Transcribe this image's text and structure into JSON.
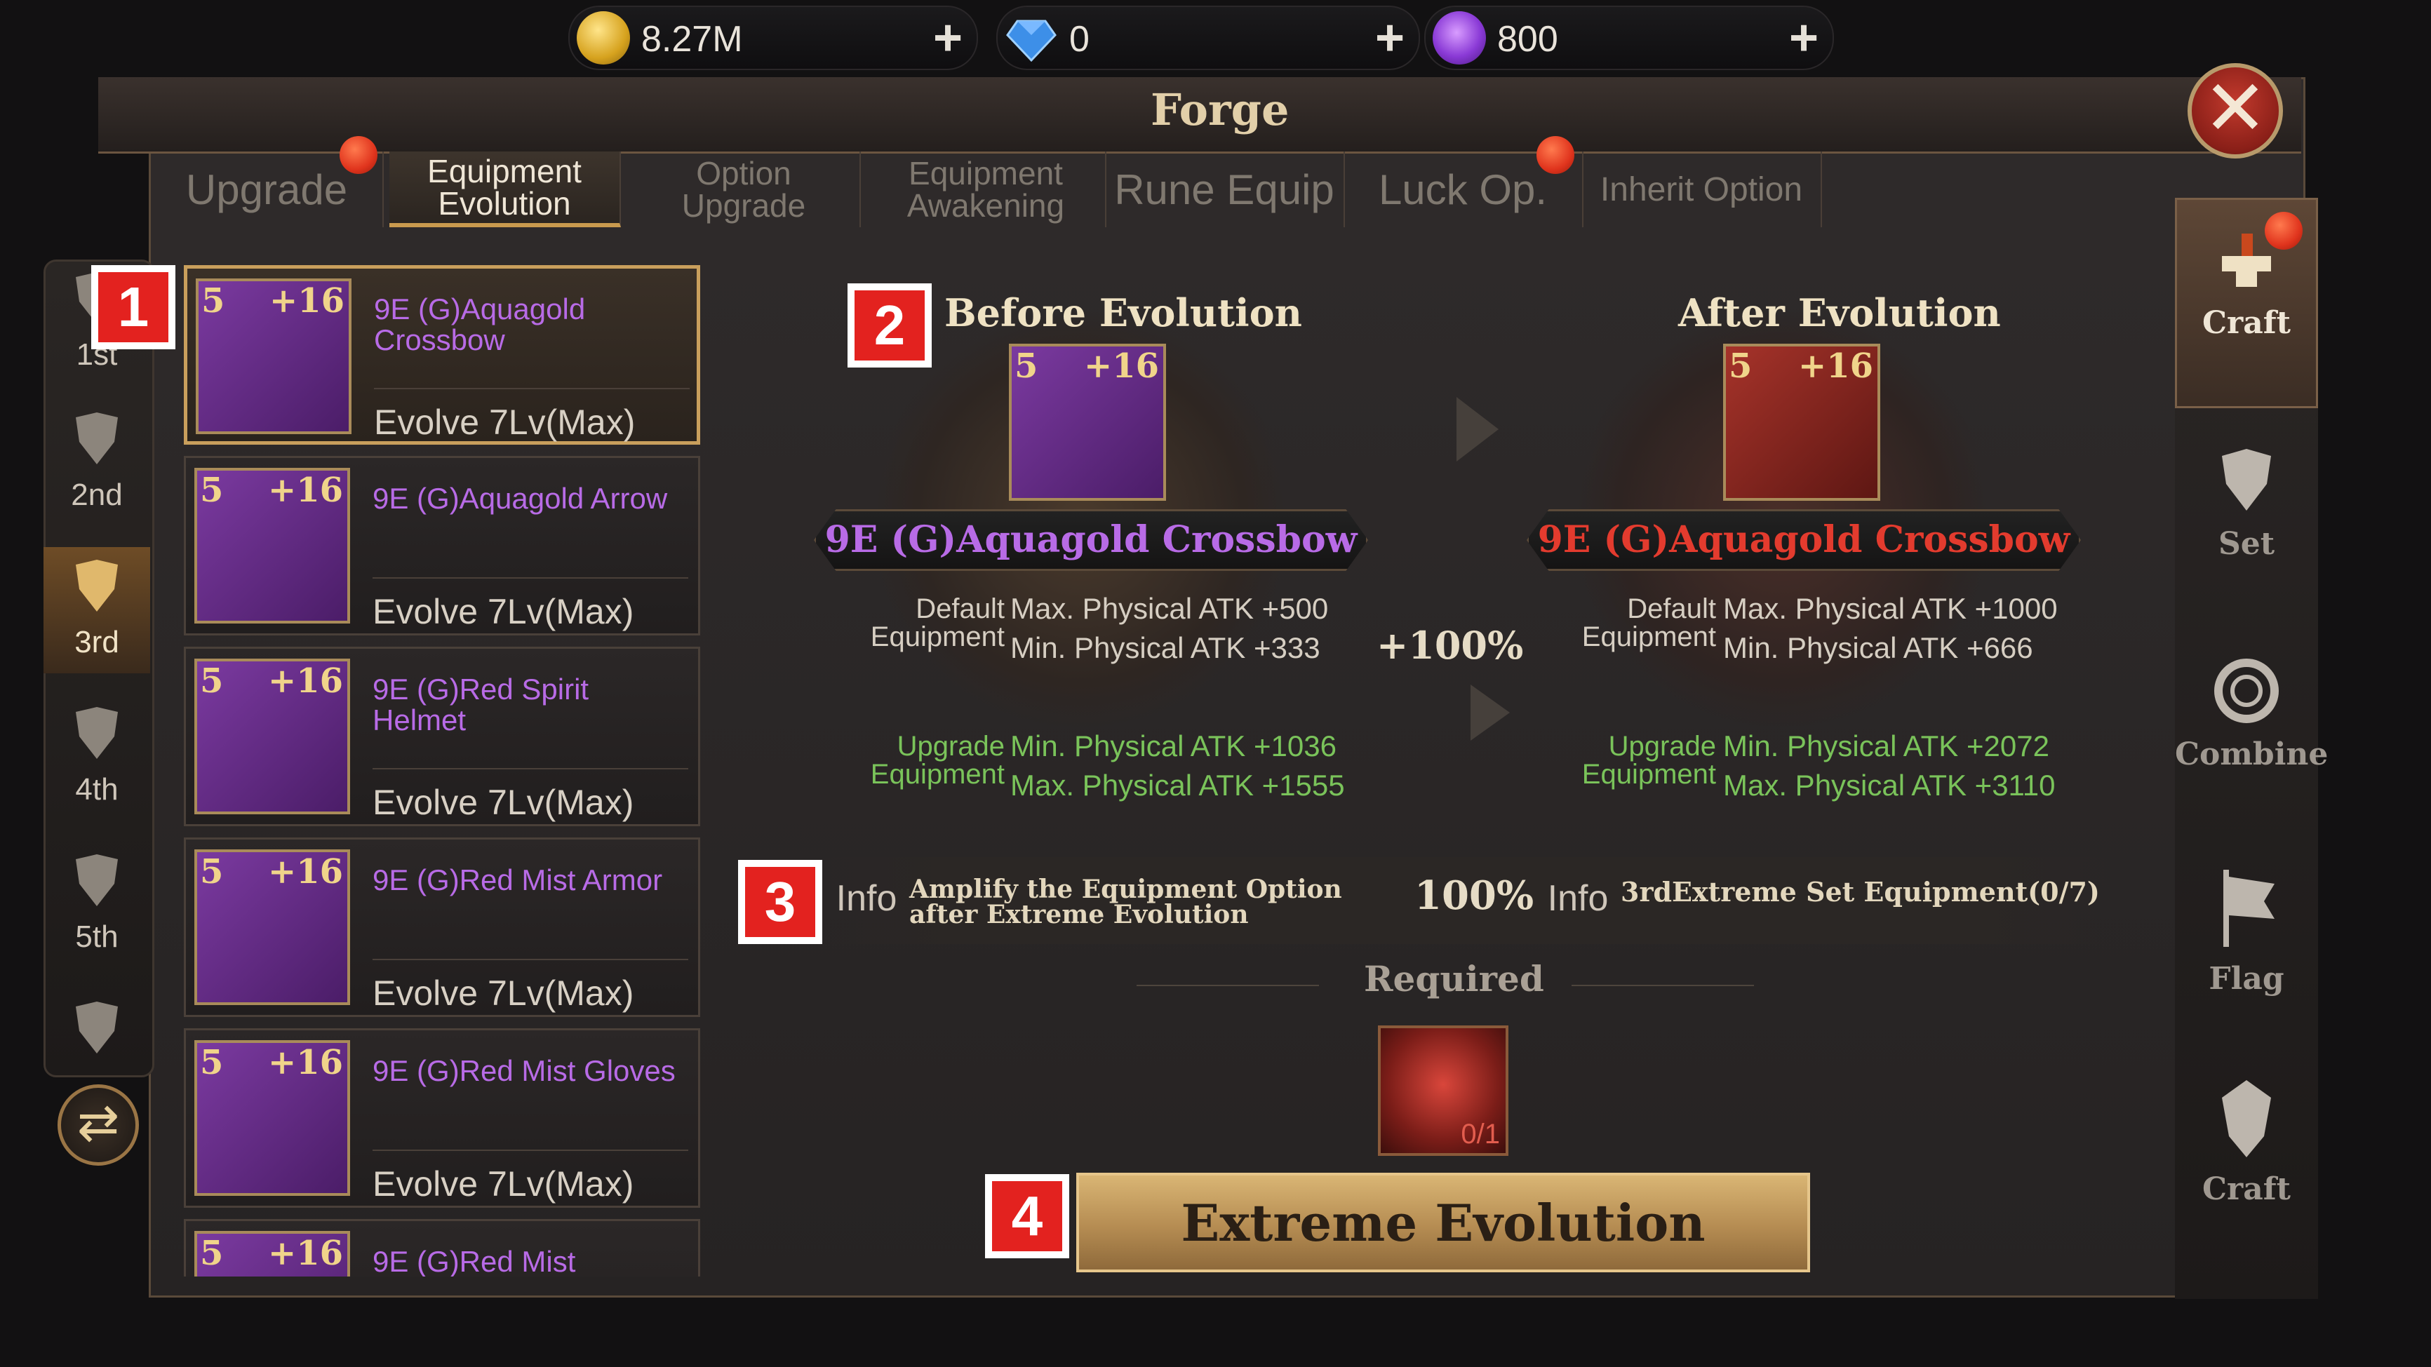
{
  "currency": {
    "gold": "8.27M",
    "diamond": "0",
    "purple": "800"
  },
  "window": {
    "title": "Forge"
  },
  "tabs": [
    {
      "label": "Upgrade"
    },
    {
      "label": "Equipment Evolution"
    },
    {
      "label": "Option Upgrade"
    },
    {
      "label": "Equipment Awakening"
    },
    {
      "label": "Rune Equip"
    },
    {
      "label": "Luck Op."
    },
    {
      "label": "Inherit Option"
    }
  ],
  "tiers": [
    {
      "label": "1st"
    },
    {
      "label": "2nd"
    },
    {
      "label": "3rd"
    },
    {
      "label": "4th"
    },
    {
      "label": "5th"
    }
  ],
  "items": [
    {
      "stars": "5",
      "level": "+16",
      "name": "9E (G)Aquagold Crossbow",
      "evolve": "Evolve 7Lv(Max)"
    },
    {
      "stars": "5",
      "level": "+16",
      "name": "9E (G)Aquagold Arrow",
      "evolve": "Evolve 7Lv(Max)"
    },
    {
      "stars": "5",
      "level": "+16",
      "name": "9E (G)Red Spirit Helmet",
      "evolve": "Evolve 7Lv(Max)"
    },
    {
      "stars": "5",
      "level": "+16",
      "name": "9E (G)Red Mist Armor",
      "evolve": "Evolve 7Lv(Max)"
    },
    {
      "stars": "5",
      "level": "+16",
      "name": "9E (G)Red Mist Gloves",
      "evolve": "Evolve 7Lv(Max)"
    },
    {
      "stars": "5",
      "level": "+16",
      "name": "9E (G)Red Mist",
      "evolve": ""
    }
  ],
  "before": {
    "heading": "Before Evolution",
    "stars": "5",
    "level": "+16",
    "name": "9E (G)Aquagold Crossbow",
    "default_label": "Default\nEquipment",
    "default_stats": [
      "Max. Physical ATK +500",
      "Min. Physical ATK +333"
    ],
    "upgrade_label": "Upgrade\nEquipment",
    "upgrade_stats": [
      "Min. Physical ATK +1036",
      "Max. Physical ATK +1555"
    ]
  },
  "after": {
    "heading": "After Evolution",
    "stars": "5",
    "level": "+16",
    "name": "9E (G)Aquagold Crossbow",
    "default_label": "Default\nEquipment",
    "default_stats": [
      "Max. Physical ATK +1000",
      "Min. Physical ATK +666"
    ],
    "upgrade_label": "Upgrade\nEquipment",
    "upgrade_stats": [
      "Min. Physical ATK +2072",
      "Max. Physical ATK +3110"
    ]
  },
  "increase": "+100%",
  "info": {
    "badge": "Info",
    "left_text": "Amplify the Equipment Option after Extreme Evolution",
    "left_value": "100%",
    "right_text": "3rdExtreme Set Equipment(0/7)"
  },
  "required": {
    "label": "Required",
    "count": "0/1"
  },
  "action": {
    "label": "Extreme Evolution"
  },
  "sidebar": [
    {
      "label": "Craft"
    },
    {
      "label": "Set"
    },
    {
      "label": "Combine"
    },
    {
      "label": "Flag"
    },
    {
      "label": "Craft"
    }
  ],
  "markers": [
    "1",
    "2",
    "3",
    "4"
  ],
  "colors": {
    "accent_gold": "#c99f5c",
    "item_name_purple": "#b86be6",
    "after_name_red": "#e33b2e",
    "stat_green": "#7ac35a",
    "notify_red": "#e0341d"
  }
}
